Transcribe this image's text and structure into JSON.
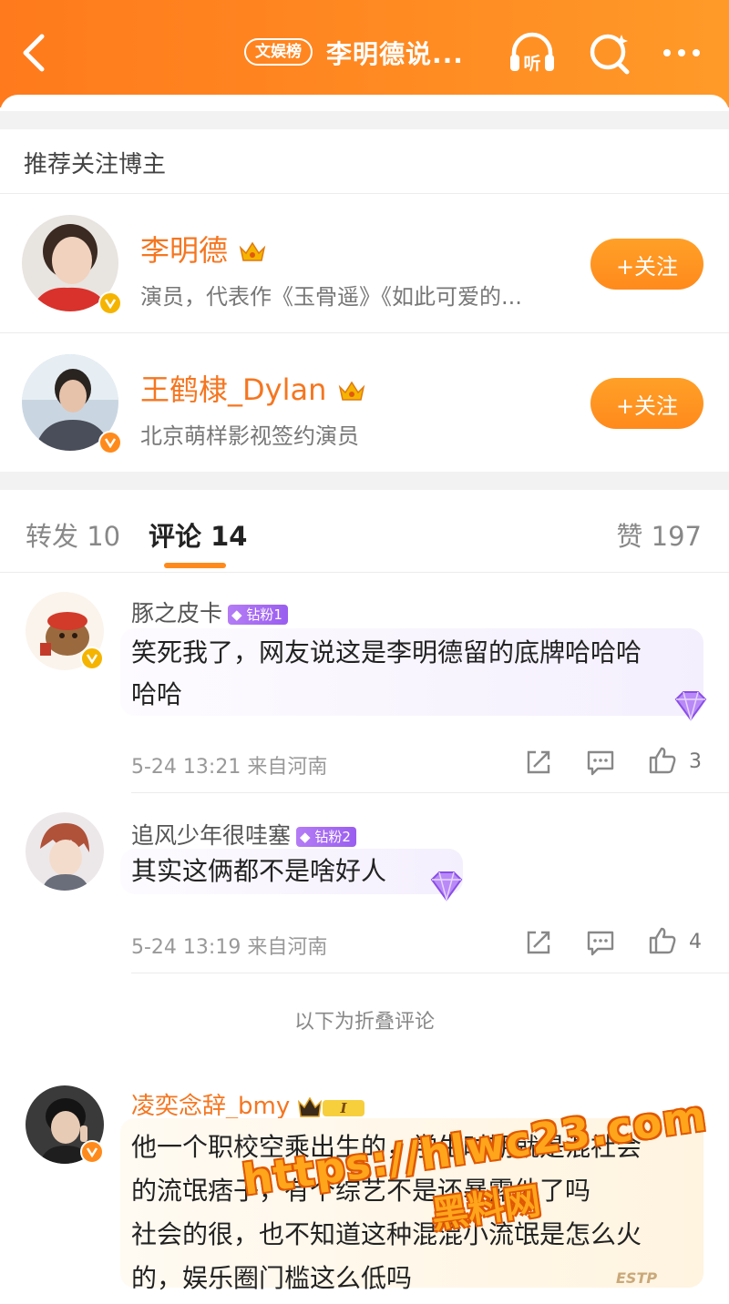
{
  "header": {
    "badge": "文娱榜",
    "title": "李明德说...",
    "listen_label": "听"
  },
  "recommend": {
    "heading": "推荐关注博主",
    "users": [
      {
        "name": "李明德",
        "desc": "演员，代表作《玉骨遥》《如此可爱的...",
        "follow": "+关注",
        "verify_color": "#f5b400"
      },
      {
        "name": "王鹤棣_Dylan",
        "desc": "北京萌样影视签约演员",
        "follow": "+关注",
        "verify_color": "#ff8a1c"
      }
    ]
  },
  "tabs": {
    "repost": "转发 10",
    "comment": "评论 14",
    "like": "赞 197"
  },
  "comments": [
    {
      "name": "豚之皮卡",
      "badge": "钻粉1",
      "text_line1": "笑死我了，网友说这是李明德留的底牌哈哈哈",
      "text_line2": "哈哈",
      "meta": "5-24 13:21 来自河南",
      "likes": "3"
    },
    {
      "name": "追风少年很哇塞",
      "badge": "钻粉2",
      "text_line1": "其实这俩都不是啥好人",
      "meta": "5-24 13:19 来自河南",
      "likes": "4"
    }
  ],
  "folded_label": "以下为折叠评论",
  "vip_comment": {
    "name": "凌奕念辞_bmy",
    "vip_level": "I",
    "lines": [
      "他一个职校空乘出生的，学生时期就是混社会",
      "的流氓痞子，有个综艺不是还暴露他了吗",
      "社会的很，也不知道这种混混小流氓是怎么火",
      "的，娱乐圈门槛这么低吗"
    ],
    "decor_text": "ESTP"
  },
  "watermark": {
    "line1": "https://hlwc23.com",
    "line2": "黑料网"
  },
  "colors": {
    "brand_orange": "#ff8a1c",
    "name_orange": "#f57620",
    "diamond_purple": "#9a5ef0"
  }
}
